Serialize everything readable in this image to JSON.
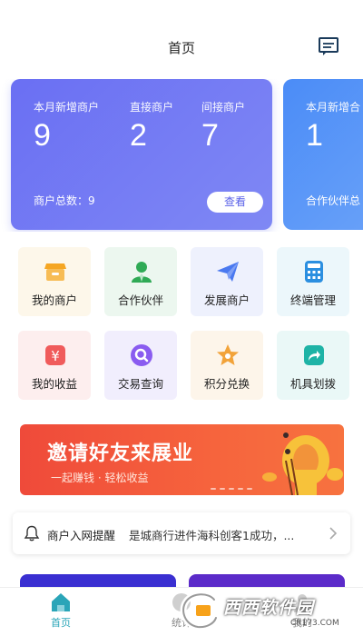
{
  "header": {
    "title": "首页",
    "message_icon": "message-icon"
  },
  "cards": [
    {
      "stats": [
        {
          "label": "本月新增商户",
          "value": "9"
        },
        {
          "label": "直接商户",
          "value": "2"
        },
        {
          "label": "间接商户",
          "value": "7"
        }
      ],
      "total": "商户总数：9",
      "button": "查看"
    },
    {
      "stats": [
        {
          "label": "本月新增合",
          "value": "1"
        }
      ],
      "total": "合作伙伴总"
    }
  ],
  "grid": [
    {
      "label": "我的商户",
      "icon": "shop-icon",
      "bg": "#fdf7ea",
      "color": "#f5a623"
    },
    {
      "label": "合作伙伴",
      "icon": "partner-icon",
      "bg": "#ecf7ef",
      "color": "#2faa55"
    },
    {
      "label": "发展商户",
      "icon": "paper-plane-icon",
      "bg": "#eef1fd",
      "color": "#4a79f0"
    },
    {
      "label": "终端管理",
      "icon": "calculator-icon",
      "bg": "#ecf7fb",
      "color": "#2b8fe0"
    },
    {
      "label": "我的收益",
      "icon": "yen-icon",
      "bg": "#fdeeee",
      "color": "#f05b5b"
    },
    {
      "label": "交易查询",
      "icon": "search-icon",
      "bg": "#f1eefd",
      "color": "#8a5cf0"
    },
    {
      "label": "积分兑换",
      "icon": "star-icon",
      "bg": "#fdf5ea",
      "color": "#f2a33a"
    },
    {
      "label": "机具划拨",
      "icon": "share-icon",
      "bg": "#eaf8f7",
      "color": "#1eb3a6"
    }
  ],
  "banner": {
    "title": "邀请好友来展业",
    "subtitle": "一起赚钱 · 轻松收益"
  },
  "notice": {
    "label": "商户入网提醒",
    "text": "是城商行进件海科创客1成功，..."
  },
  "tabbar": [
    {
      "label": "首页",
      "icon": "home-icon",
      "active": true
    },
    {
      "label": "统计",
      "icon": "chart-icon",
      "active": false
    },
    {
      "label": "我的",
      "icon": "user-icon",
      "active": false
    }
  ],
  "watermark": {
    "text": "西西软件园",
    "sub": "CR173.COM"
  }
}
